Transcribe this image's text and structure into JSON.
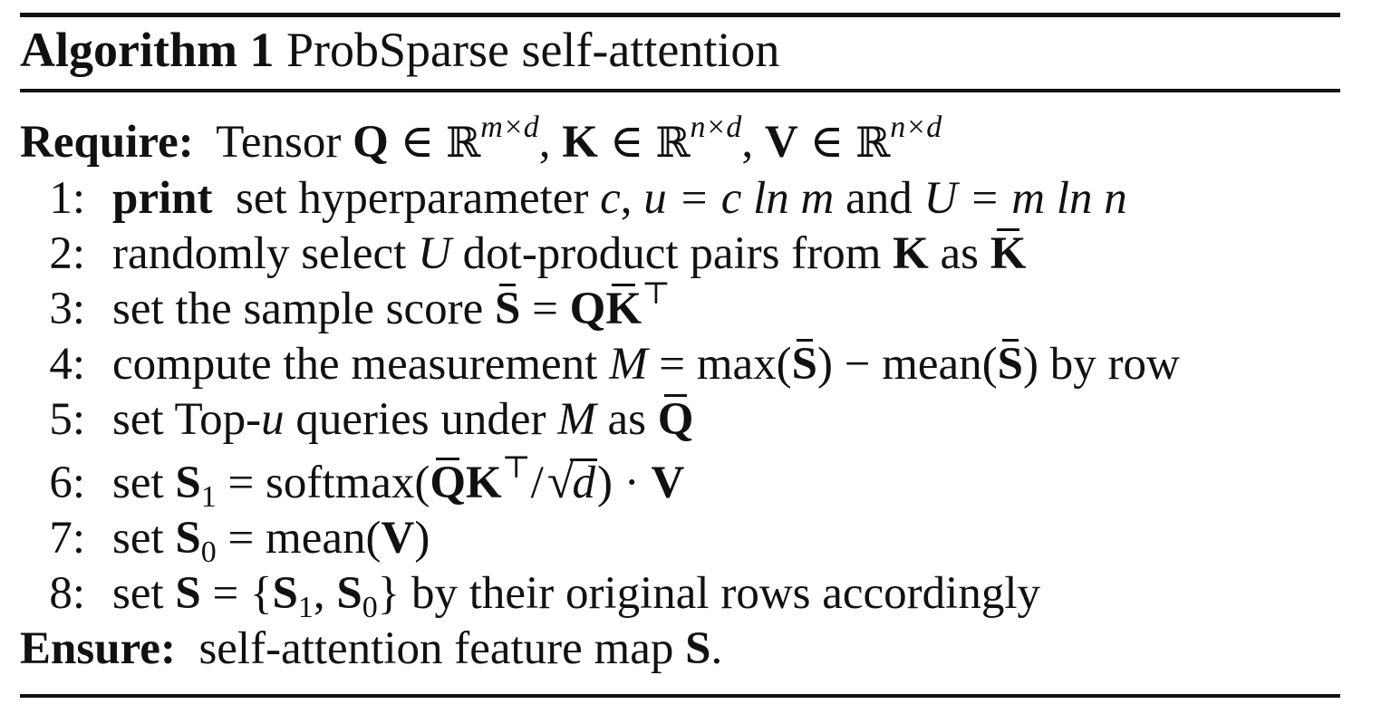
{
  "algorithm": {
    "label": "Algorithm 1",
    "title": "ProbSparse self-attention"
  },
  "require": {
    "keyword": "Require:",
    "text": "Tensor",
    "tensors": [
      {
        "symbol": "Q",
        "set": "ℝ",
        "dims": "m×d"
      },
      {
        "symbol": "K",
        "set": "ℝ",
        "dims": "n×d"
      },
      {
        "symbol": "V",
        "set": "ℝ",
        "dims": "n×d"
      }
    ]
  },
  "steps": [
    {
      "n": "1:",
      "keyword": "print",
      "text": "set hyperparameter",
      "c": "c",
      "u_eq": "u = c ln m",
      "and": "and",
      "U_eq": "U = m ln n"
    },
    {
      "n": "2:",
      "text_a": "randomly select",
      "var": "U",
      "text_b": "dot-product pairs from",
      "from": "K",
      "as": "as",
      "to": "K"
    },
    {
      "n": "3:",
      "text": "set the sample score",
      "lhs": "S",
      "eq": "=",
      "rhs_a": "Q",
      "rhs_b": "K",
      "transpose": "⊤"
    },
    {
      "n": "4:",
      "text": "compute the measurement",
      "var": "M",
      "eq": "=",
      "max": "max",
      "minus": "−",
      "mean": "mean",
      "arg": "S",
      "tail": "by row"
    },
    {
      "n": "5:",
      "text_a": "set Top-",
      "u": "u",
      "text_b": "queries under",
      "var": "M",
      "as": "as",
      "to": "Q"
    },
    {
      "n": "6:",
      "text": "set",
      "lhs": "S",
      "sub": "1",
      "eq": "=",
      "fn": "softmax",
      "q": "Q",
      "k": "K",
      "transpose": "⊤",
      "slash": "/",
      "d": "d",
      "dot": "·",
      "v": "V"
    },
    {
      "n": "7:",
      "text": "set",
      "lhs": "S",
      "sub": "0",
      "eq": "=",
      "fn": "mean",
      "arg": "V"
    },
    {
      "n": "8:",
      "text": "set",
      "lhs": "S",
      "eq": "=",
      "s1": "S",
      "sub1": "1",
      "s0": "S",
      "sub0": "0",
      "tail": "by their original rows accordingly"
    }
  ],
  "ensure": {
    "keyword": "Ensure:",
    "text": "self-attention feature map",
    "symbol": "S",
    "period": "."
  }
}
